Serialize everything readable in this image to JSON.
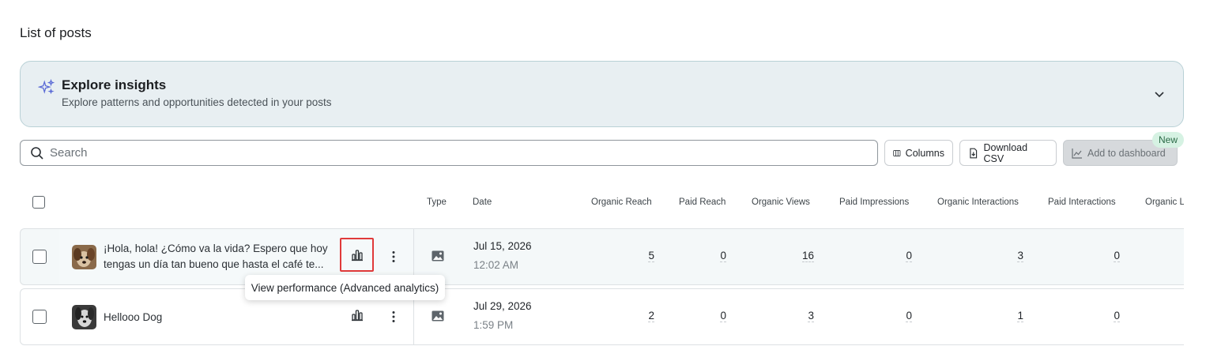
{
  "page_title": "List of posts",
  "insights": {
    "title": "Explore insights",
    "subtitle": "Explore patterns and opportunities detected in your posts"
  },
  "search": {
    "placeholder": "Search",
    "value": ""
  },
  "toolbar": {
    "columns_label": "Columns",
    "download_label": "Download CSV",
    "dashboard_label": "Add to dashboard",
    "new_badge": "New"
  },
  "table": {
    "headers": [
      "Type",
      "Date",
      "Organic Reach",
      "Paid Reach",
      "Organic Views",
      "Paid Impressions",
      "Organic Interactions",
      "Paid Interactions",
      "Organic L"
    ],
    "rows": [
      {
        "text": "¡Hola, hola! ¿Cómo va la vida? Espero que hoy tengas un día tan bueno que hasta el café te...",
        "type_icon": "image-icon",
        "date": "Jul 15, 2026",
        "time": "12:02 AM",
        "organic_reach": "5",
        "paid_reach": "0",
        "organic_views": "16",
        "paid_impressions": "0",
        "organic_interactions": "3",
        "paid_interactions": "0"
      },
      {
        "text": "Hellooo Dog",
        "type_icon": "image-icon",
        "date": "Jul 29, 2026",
        "time": "1:59 PM",
        "organic_reach": "2",
        "paid_reach": "0",
        "organic_views": "3",
        "paid_impressions": "0",
        "organic_interactions": "1",
        "paid_interactions": "0"
      }
    ]
  },
  "tooltip": "View performance (Advanced analytics)",
  "colors": {
    "highlight": "#e03a3a",
    "insights_bg": "#e8eff2",
    "new_badge_bg": "#d6f2e3"
  }
}
